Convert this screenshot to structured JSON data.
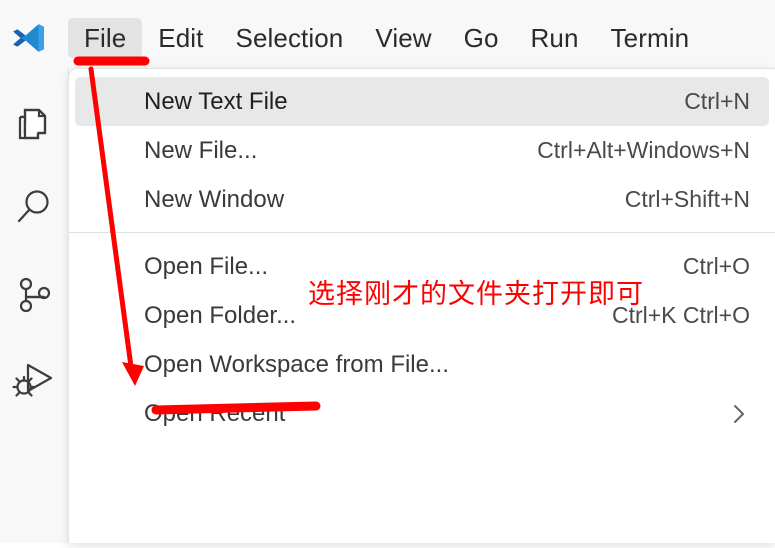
{
  "app": {
    "name": "Visual Studio Code",
    "logo_icon": "vscode-logo"
  },
  "menubar": {
    "items": [
      {
        "label": "File",
        "active": true
      },
      {
        "label": "Edit",
        "active": false
      },
      {
        "label": "Selection",
        "active": false
      },
      {
        "label": "View",
        "active": false
      },
      {
        "label": "Go",
        "active": false
      },
      {
        "label": "Run",
        "active": false
      },
      {
        "label": "Termin",
        "active": false
      }
    ]
  },
  "activitybar": {
    "items": [
      {
        "name": "explorer",
        "icon": "files-icon",
        "title": "Explorer"
      },
      {
        "name": "search",
        "icon": "search-icon",
        "title": "Search"
      },
      {
        "name": "source-control",
        "icon": "source-control-icon",
        "title": "Source Control"
      },
      {
        "name": "run-and-debug",
        "icon": "run-and-debug-icon",
        "title": "Run and Debug"
      }
    ]
  },
  "file_menu": {
    "items": [
      {
        "label": "New Text File",
        "shortcut": "Ctrl+N",
        "selected": true,
        "submenu": false,
        "separator_after": false
      },
      {
        "label": "New File...",
        "shortcut": "Ctrl+Alt+Windows+N",
        "selected": false,
        "submenu": false,
        "separator_after": false
      },
      {
        "label": "New Window",
        "shortcut": "Ctrl+Shift+N",
        "selected": false,
        "submenu": false,
        "separator_after": true
      },
      {
        "label": "Open File...",
        "shortcut": "Ctrl+O",
        "selected": false,
        "submenu": false,
        "separator_after": false
      },
      {
        "label": "Open Folder...",
        "shortcut": "Ctrl+K Ctrl+O",
        "selected": false,
        "submenu": false,
        "separator_after": false
      },
      {
        "label": "Open Workspace from File...",
        "shortcut": "",
        "selected": false,
        "submenu": false,
        "separator_after": false
      },
      {
        "label": "Open Recent",
        "shortcut": "",
        "selected": false,
        "submenu": true,
        "separator_after": false
      }
    ]
  },
  "annotations": {
    "color": "#ff0000",
    "note_text": "选择刚才的文件夹打开即可",
    "underline_file_menu": true,
    "underline_open_folder": true,
    "arrow_from_file_to_open_folder": true
  },
  "colors": {
    "accent": "#0a6cc6",
    "annotation_red": "#ff0000",
    "menu_background": "#ffffff",
    "menu_selected": "#e8e8e8",
    "titlebar_background": "#f8f8f8"
  }
}
